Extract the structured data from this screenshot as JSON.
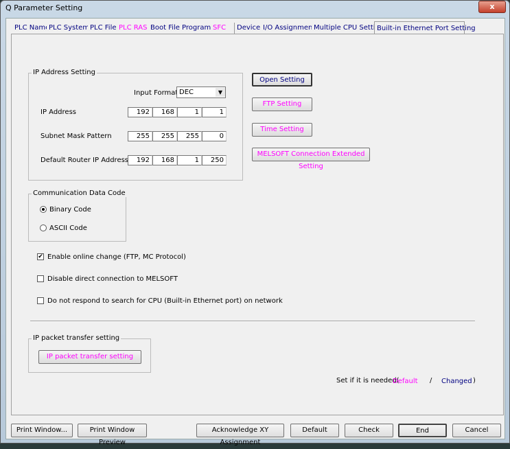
{
  "window": {
    "title": "Q Parameter Setting",
    "close": "x"
  },
  "tabs": [
    {
      "label": "PLC Name",
      "state": "changed"
    },
    {
      "label": "PLC System",
      "state": "changed"
    },
    {
      "label": "PLC File",
      "state": "changed"
    },
    {
      "label": "PLC RAS",
      "state": "default"
    },
    {
      "label": "Boot File",
      "state": "changed"
    },
    {
      "label": "Program",
      "state": "changed"
    },
    {
      "label": "SFC",
      "state": "default"
    },
    {
      "label": "Device",
      "state": "changed"
    },
    {
      "label": "I/O Assignment",
      "state": "changed"
    },
    {
      "label": "Multiple CPU Setting",
      "state": "changed"
    },
    {
      "label": "Built-in Ethernet Port Setting",
      "state": "active"
    }
  ],
  "ip_setting": {
    "legend": "IP Address Setting",
    "input_format_label": "Input Format",
    "input_format": "DEC",
    "ip_label": "IP Address",
    "ip": [
      "192",
      "168",
      "1",
      "1"
    ],
    "subnet_label": "Subnet Mask Pattern",
    "subnet": [
      "255",
      "255",
      "255",
      "0"
    ],
    "router_label": "Default Router IP Address",
    "router": [
      "192",
      "168",
      "1",
      "250"
    ]
  },
  "side_buttons": {
    "open": "Open Setting",
    "ftp": "FTP Setting",
    "time": "Time Setting",
    "melsoft": "MELSOFT Connection Extended Setting"
  },
  "comm_code": {
    "legend": "Communication Data Code",
    "binary": "Binary Code",
    "ascii": "ASCII Code",
    "selected": "Binary Code"
  },
  "checks": [
    {
      "label": "Enable online change (FTP, MC Protocol)",
      "checked": true
    },
    {
      "label": "Disable direct connection to MELSOFT",
      "checked": false
    },
    {
      "label": "Do not respond to search for CPU (Built-in Ethernet port) on network",
      "checked": false
    }
  ],
  "ip_packet": {
    "legend": "IP packet transfer setting",
    "button": "IP packet transfer setting"
  },
  "legend_note": {
    "prefix": "Set if it is needed(",
    "default": "Default",
    "slash": "/",
    "changed": "Changed",
    "suffix": ")"
  },
  "colors": {
    "default": "#ff00ff",
    "changed": "#000080"
  },
  "bottom": {
    "print": "Print Window...",
    "preview": "Print Window Preview",
    "ack": "Acknowledge XY Assignment",
    "default": "Default",
    "check": "Check",
    "end": "End",
    "cancel": "Cancel"
  }
}
